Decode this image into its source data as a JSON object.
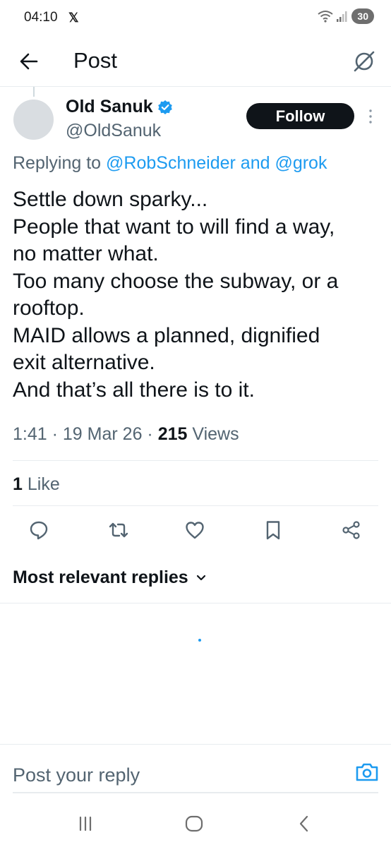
{
  "status_bar": {
    "time": "04:10",
    "app_icon": "x-logo-icon",
    "battery": "30"
  },
  "header": {
    "title": "Post"
  },
  "post": {
    "author_name": "Old Sanuk",
    "author_handle": "@OldSanuk",
    "verified": true,
    "follow_label": "Follow",
    "replying_prefix": "Replying to",
    "replying_to": "@RobSchneider and @grok",
    "text_lines": [
      "Settle down sparky...",
      "People that want to will find a way,",
      "no matter what.",
      "Too many choose the subway, or a",
      "rooftop.",
      "MAID allows a planned, dignified",
      "exit alternative.",
      "And that’s all there is to it."
    ],
    "time": "1:41",
    "date": "19 Mar 26",
    "views_count": "215",
    "views_label": "Views",
    "likes_count": "1",
    "likes_label": "Like"
  },
  "actions": [
    "reply-icon",
    "repost-icon",
    "like-icon",
    "bookmark-icon",
    "share-icon"
  ],
  "replies": {
    "sort_label": "Most relevant replies"
  },
  "composer": {
    "placeholder": "Post your reply"
  },
  "colors": {
    "accent": "#1d9bf0",
    "text": "#0f1419",
    "secondary": "#536471",
    "divider": "#e8ecef"
  }
}
